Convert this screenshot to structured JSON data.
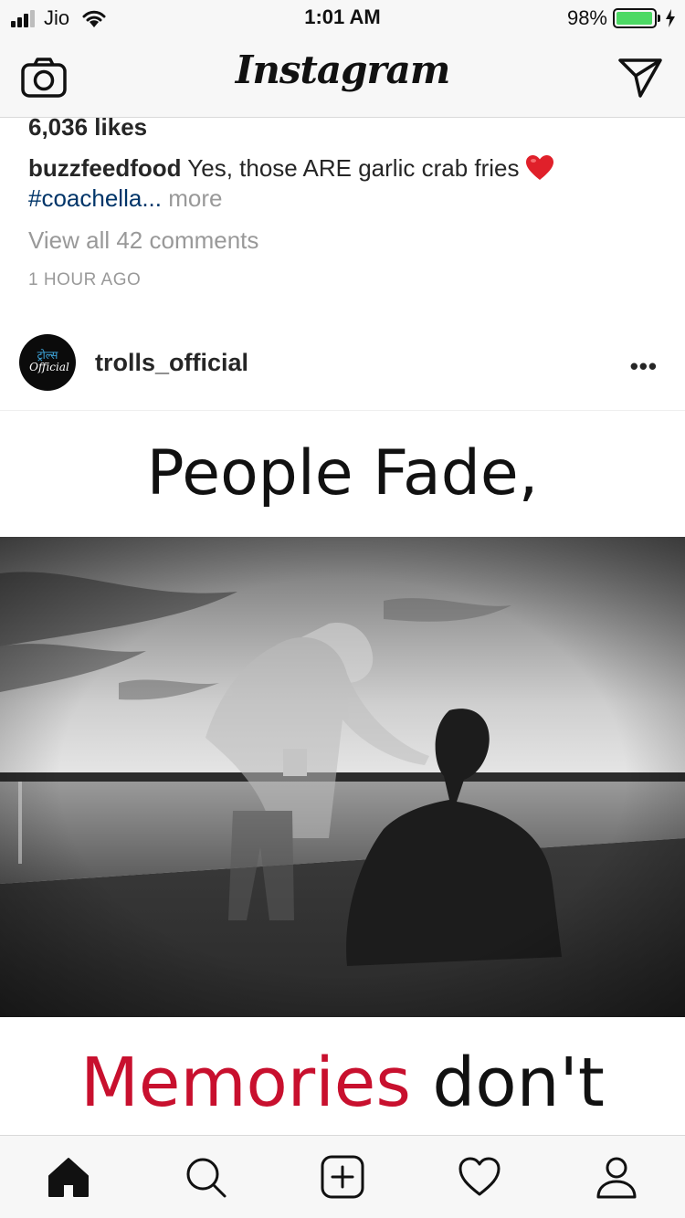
{
  "status_bar": {
    "carrier": "Jio",
    "time": "1:01 AM",
    "battery_percent": "98%",
    "battery_level": 0.98,
    "battery_color": "#4cd964"
  },
  "nav": {
    "title": "Instagram",
    "left_icon": "camera-icon",
    "right_icon": "direct-message-icon"
  },
  "previous_post": {
    "likes": "6,036 likes",
    "caption_user": "buzzfeedfood",
    "caption_text": " Yes, those ARE garlic crab fries",
    "caption_hashtag": "#coachella...",
    "caption_more": " more",
    "view_comments": "View all 42 comments",
    "time_ago": "1 HOUR AGO"
  },
  "post": {
    "username": "trolls_official",
    "options_label": "•••",
    "avatar_text": [
      "ट्रोल्स",
      "Official"
    ],
    "image_text_top": "People Fade,",
    "image_text_bottom_red": "Memories",
    "image_text_bottom_dark": " don't"
  },
  "tab_bar": {
    "items": [
      "home-icon",
      "search-icon",
      "add-post-icon",
      "activity-heart-icon",
      "profile-icon"
    ],
    "active": "home-icon"
  },
  "colors": {
    "hashtag": "#003569",
    "muted": "#999999",
    "memories_red": "#c8102e",
    "bar_background": "#f7f7f7"
  }
}
